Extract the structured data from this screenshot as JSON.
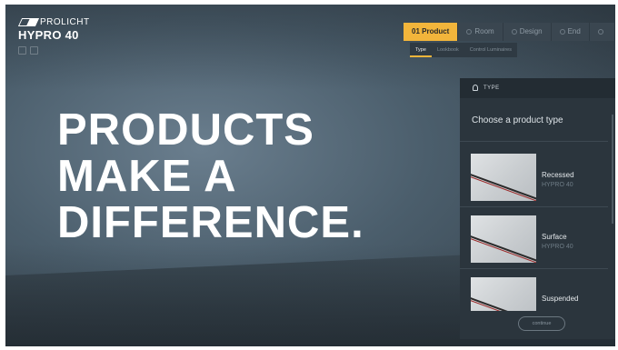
{
  "brand": {
    "company": "PROLICHT",
    "product": "HYPRO 40"
  },
  "hero": {
    "lines": [
      "PRODUCTS",
      "MAKE A",
      "DIFFERENCE."
    ]
  },
  "steps": [
    {
      "label": "01 Product",
      "active": true
    },
    {
      "label": "Room",
      "active": false
    },
    {
      "label": "Design",
      "active": false
    },
    {
      "label": "End",
      "active": false
    }
  ],
  "subtabs": [
    {
      "label": "Type",
      "active": true
    },
    {
      "label": "Lookbook",
      "active": false
    },
    {
      "label": "Control Luminaires",
      "active": false
    }
  ],
  "panel": {
    "header": "TYPE",
    "prompt": "Choose a product type",
    "items": [
      {
        "name": "Recessed",
        "sub": "HYPRO 40"
      },
      {
        "name": "Surface",
        "sub": "HYPRO 40"
      },
      {
        "name": "Suspended",
        "sub": ""
      }
    ],
    "continue_label": "continue"
  },
  "colors": {
    "accent": "#f2b53b",
    "panel": "#2b353d",
    "background": "#4b5e6c"
  }
}
